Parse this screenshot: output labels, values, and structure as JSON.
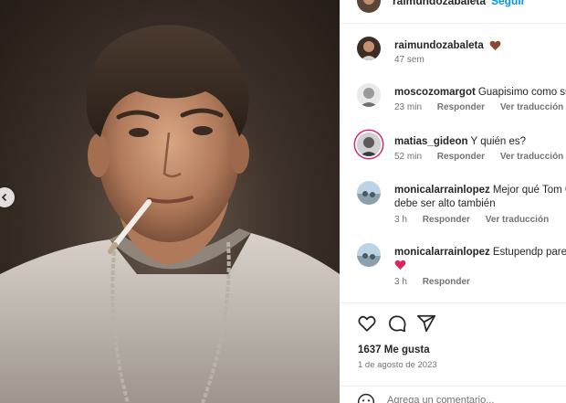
{
  "post": {
    "author": "raimundozabaleta",
    "follow_label": "Seguir",
    "separator": "•"
  },
  "caption": {
    "user": "raimundozabaleta",
    "emoji": "heart-emoji-brown",
    "time": "47 sem"
  },
  "comments": [
    {
      "user": "moscozomargot",
      "text": "Guapisimo como su",
      "time": "23 min",
      "reply": "Responder",
      "translate": "Ver traducción"
    },
    {
      "user": "matias_gideon",
      "text": "Y quién es?",
      "time": "52 min",
      "reply": "Responder",
      "translate": "Ver traducción"
    },
    {
      "user": "monicalarrainlopez",
      "text": "Mejor qué Tom C",
      "text2": "debe ser alto también",
      "time": "3 h",
      "reply": "Responder",
      "translate": "Ver traducción"
    },
    {
      "user": "monicalarrainlopez",
      "text": "Estupendp parec",
      "emoji": "red-heart-emoji",
      "time": "3 h",
      "reply": "Responder"
    }
  ],
  "actions": {
    "likes": "1637 Me gusta",
    "date": "1 de agosto de 2023",
    "icons": [
      "heart-icon",
      "comment-icon",
      "share-icon"
    ]
  },
  "composer": {
    "placeholder": "Agrega un comentario..."
  },
  "colors": {
    "link": "#0095f6",
    "secondary_text": "#737373",
    "story_ring": "#d62976",
    "divider": "#efefef"
  }
}
